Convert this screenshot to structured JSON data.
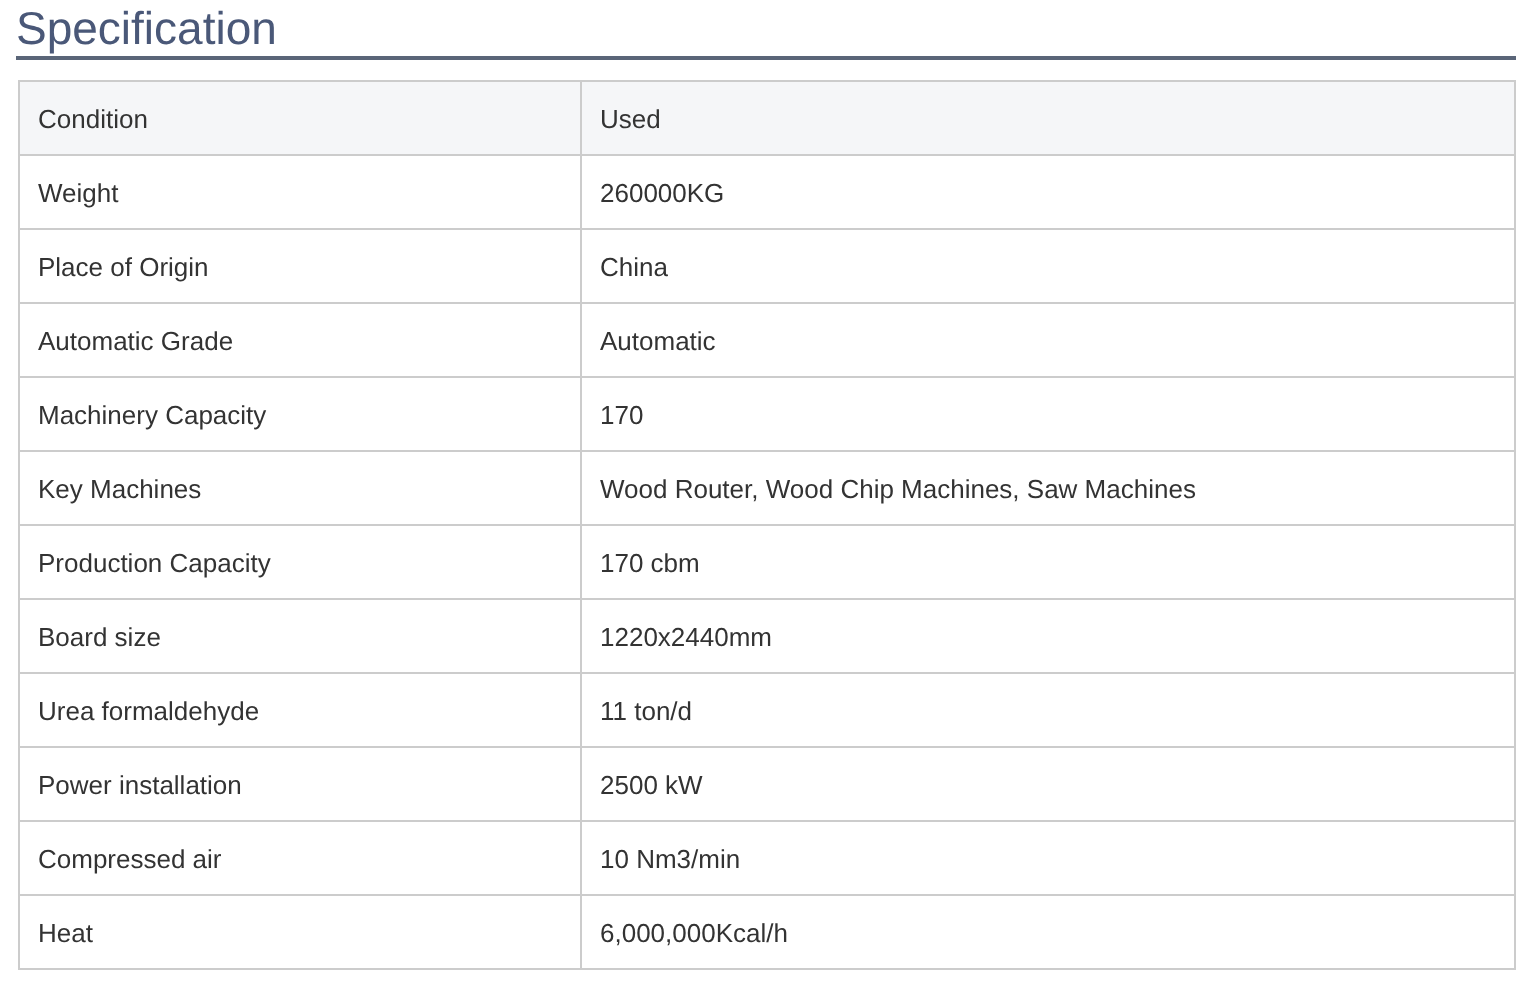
{
  "title": "Specification",
  "table": {
    "header": {
      "label": "Condition",
      "value": "Used"
    },
    "rows": [
      {
        "label": "Weight",
        "value": "260000KG"
      },
      {
        "label": "Place of Origin",
        "value": "China"
      },
      {
        "label": "Automatic Grade",
        "value": "Automatic"
      },
      {
        "label": "Machinery Capacity",
        "value": "170"
      },
      {
        "label": "Key Machines",
        "value": "Wood Router, Wood Chip Machines, Saw Machines"
      },
      {
        "label": "Production Capacity",
        "value": "170 cbm"
      },
      {
        "label": "Board size",
        "value": "1220x2440mm"
      },
      {
        "label": "Urea formaldehyde",
        "value": "11 ton/d"
      },
      {
        "label": "Power installation",
        "value": "2500 kW"
      },
      {
        "label": "Compressed air",
        "value": "10 Nm3/min"
      },
      {
        "label": "Heat",
        "value": "6,000,000Kcal/h"
      }
    ]
  }
}
